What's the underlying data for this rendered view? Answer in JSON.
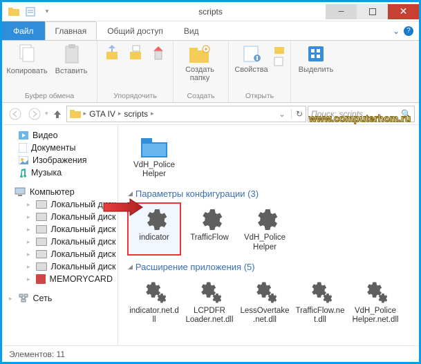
{
  "window": {
    "title": "scripts"
  },
  "ribbon": {
    "file": "Файл",
    "tabs": {
      "home": "Главная",
      "share": "Общий доступ",
      "view": "Вид"
    },
    "groups": {
      "clipboard": {
        "label": "Буфер обмена",
        "copy": "Копировать",
        "paste": "Вставить"
      },
      "organize": {
        "label": "Упорядочить"
      },
      "new": {
        "label": "Создать",
        "new_folder": "Создать папку"
      },
      "open": {
        "label": "Открыть",
        "properties": "Свойства"
      },
      "select": {
        "label": "",
        "select_all": "Выделить"
      }
    }
  },
  "address": {
    "crumbs": [
      "GTA IV",
      "scripts"
    ],
    "search_placeholder": "Поиск: scripts"
  },
  "sidebar": {
    "items": [
      {
        "label": "Видео",
        "icon": "video"
      },
      {
        "label": "Документы",
        "icon": "doc"
      },
      {
        "label": "Изображения",
        "icon": "image"
      },
      {
        "label": "Музыка",
        "icon": "music"
      }
    ],
    "computer": "Компьютер",
    "drives": [
      "Локальный диск",
      "Локальный диск",
      "Локальный диск",
      "Локальный диск",
      "Локальный диск",
      "Локальный диск",
      "MEMORYCARD"
    ],
    "network": "Сеть"
  },
  "content": {
    "top_files": [
      {
        "name": "VdH_Police Helper",
        "icon": "folder-blue"
      }
    ],
    "groups": [
      {
        "title": "Параметры конфигурации (3)",
        "files": [
          {
            "name": "indicator",
            "icon": "gear",
            "selected": true
          },
          {
            "name": "TrafficFlow",
            "icon": "gear"
          },
          {
            "name": "VdH_Police Helper",
            "icon": "gear"
          }
        ]
      },
      {
        "title": "Расширение приложения (5)",
        "files": [
          {
            "name": "indicator.net.dll",
            "icon": "gears"
          },
          {
            "name": "LCPDFR Loader.net.dll",
            "icon": "gears"
          },
          {
            "name": "LessOvertake.net.dll",
            "icon": "gears"
          },
          {
            "name": "TrafficFlow.net.dll",
            "icon": "gears"
          },
          {
            "name": "VdH_Police Helper.net.dll",
            "icon": "gears"
          }
        ]
      }
    ]
  },
  "statusbar": {
    "elements": "Элементов: 11"
  },
  "watermark": "www.computerhom.ru"
}
